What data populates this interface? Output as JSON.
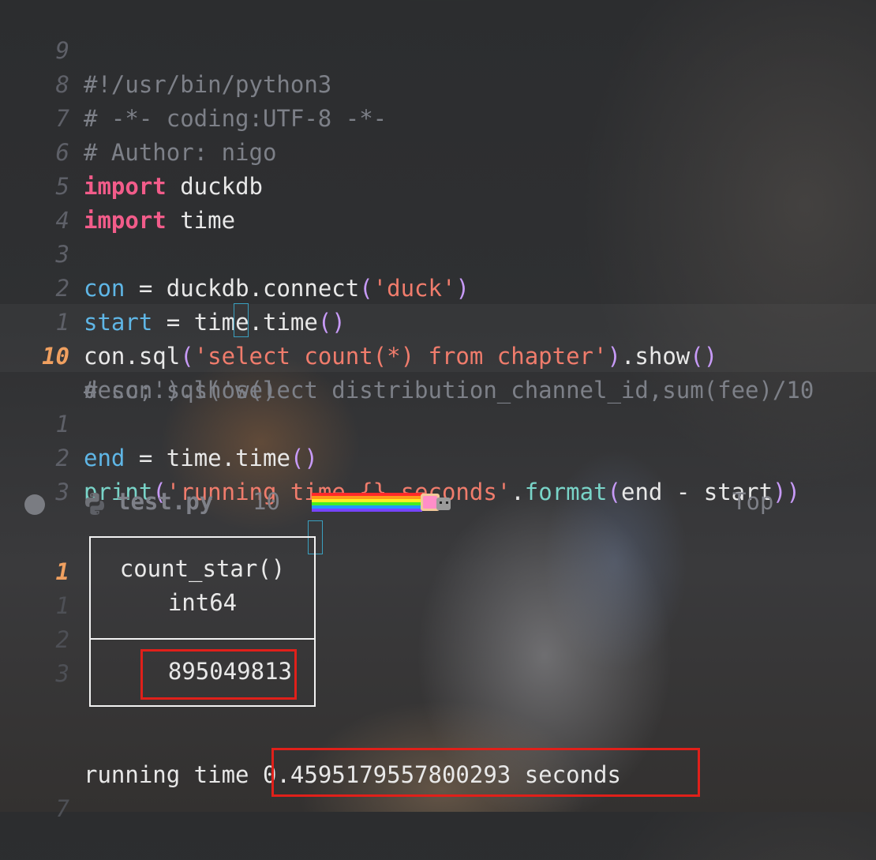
{
  "editor": {
    "lines": [
      {
        "num": "9",
        "text": "#!/usr/bin/python3"
      },
      {
        "num": "8",
        "text": "# -*- coding:UTF-8 -*-"
      },
      {
        "num": "7",
        "text": "# Author: nigo"
      },
      {
        "num": "6",
        "kw": "import",
        "rest": " duckdb"
      },
      {
        "num": "5",
        "kw": "import",
        "rest": " time"
      },
      {
        "num": "4"
      },
      {
        "num": "3",
        "var": "con",
        "op": " = duckdb.connect",
        "p1": "(",
        "str": "'duck'",
        "p2": ")"
      },
      {
        "num": "2",
        "var": "start",
        "op": " = time.time",
        "p": "()"
      },
      {
        "num": "1",
        "fn": "con.sql",
        "p1": "(",
        "str": "'select count(*) from chapter'",
        "p2": ")",
        "tail": ".show",
        "p3": "()"
      },
      {
        "num": "10",
        "text": "# con.sql('select distribution_channel_id,sum(fee)/10",
        "wrap": "desc;').show()"
      },
      {
        "num": "1",
        "var": "end",
        "op": " = time.time",
        "p": "()"
      },
      {
        "num": "2",
        "fn": "print",
        "p1": "(",
        "str": "'running time {} seconds'",
        "dot": ".",
        "fmt": "format",
        "p2": "(",
        "args": "end - start",
        "p3": "))"
      },
      {
        "num": "3"
      }
    ]
  },
  "status_bar": {
    "file_name": "test.py",
    "line_number": "10",
    "position": "Top"
  },
  "output": {
    "cursor_line": "1",
    "relative_lines": [
      "1",
      "2",
      "3"
    ],
    "table": {
      "column_name": "count_star()",
      "column_type": "int64",
      "value": "895049813"
    },
    "result_prefix": "running time ",
    "result_value": "0.4595179557800293 seconds",
    "bottom_line_number": "7"
  },
  "colors": {
    "keyword": "#f25c8a",
    "variable": "#5fb6e6",
    "string": "#f07c6c",
    "paren": "#c79af7",
    "highlight_box": "#e0201a",
    "current_line_number": "#f0a060"
  },
  "icons": [
    "status-dot-icon",
    "python-icon",
    "nyan-cat-icon"
  ]
}
